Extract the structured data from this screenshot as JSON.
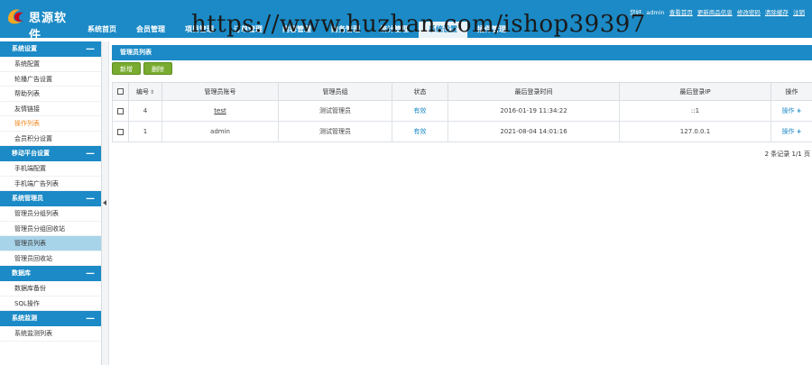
{
  "header": {
    "logo_text": "思源软件",
    "nav": [
      {
        "label": "系统首页"
      },
      {
        "label": "会员管理"
      },
      {
        "label": "项目管理"
      },
      {
        "label": "订单管理"
      },
      {
        "label": "内容管理"
      },
      {
        "label": "财务管理"
      },
      {
        "label": "统计管理"
      },
      {
        "label": "系统设置",
        "active": true
      },
      {
        "label": "插件管理"
      }
    ],
    "user": {
      "greeting": "您好,",
      "name": "admin",
      "links": [
        "查看首页",
        "更新商品信息",
        "修改密码",
        "清除缓存",
        "注销"
      ]
    },
    "watermark": "https://www.huzhan.com/ishop39397"
  },
  "sidebar": {
    "groups": [
      {
        "title": "系统设置",
        "items": [
          {
            "label": "系统配置"
          },
          {
            "label": "轮播广告设置"
          },
          {
            "label": "帮助列表"
          },
          {
            "label": "友情链接"
          },
          {
            "label": "操作列表",
            "orange": true
          },
          {
            "label": "会员积分设置"
          }
        ]
      },
      {
        "title": "移动平台设置",
        "items": [
          {
            "label": "手机端配置"
          },
          {
            "label": "手机端广告列表"
          }
        ]
      },
      {
        "title": "系统管理员",
        "items": [
          {
            "label": "管理员分组列表"
          },
          {
            "label": "管理员分组回收站"
          },
          {
            "label": "管理员列表",
            "selected": true
          },
          {
            "label": "管理员回收站"
          }
        ]
      },
      {
        "title": "数据库",
        "items": [
          {
            "label": "数据库备份"
          },
          {
            "label": "SQL操作"
          }
        ]
      },
      {
        "title": "系统监测",
        "items": [
          {
            "label": "系统监测列表"
          }
        ]
      }
    ],
    "collapse_symbol": "—"
  },
  "main": {
    "panel_title": "管理员列表",
    "toolbar": {
      "add_label": "新增",
      "delete_label": "删除"
    },
    "table": {
      "columns": [
        "",
        "编号",
        "管理员账号",
        "管理员组",
        "状态",
        "最后登录时间",
        "最后登录IP",
        "操作"
      ],
      "sort_symbol": "⇕",
      "rows": [
        {
          "id": "4",
          "account": "test",
          "group": "测试管理员",
          "status": "有效",
          "last_login": "2016-01-19 11:34:22",
          "ip": "::1",
          "op": "操作",
          "plus": "+"
        },
        {
          "id": "1",
          "account": "admin",
          "group": "测试管理员",
          "status": "有效",
          "last_login": "2021-08-04 14:01:16",
          "ip": "127.0.0.1",
          "op": "操作",
          "plus": "+"
        }
      ]
    },
    "pager": "2 条记录 1/1 页"
  },
  "colors": {
    "primary": "#1b8ac6",
    "button": "#78ab2f",
    "selected": "#a8d4ea",
    "orange": "#f08a24"
  }
}
